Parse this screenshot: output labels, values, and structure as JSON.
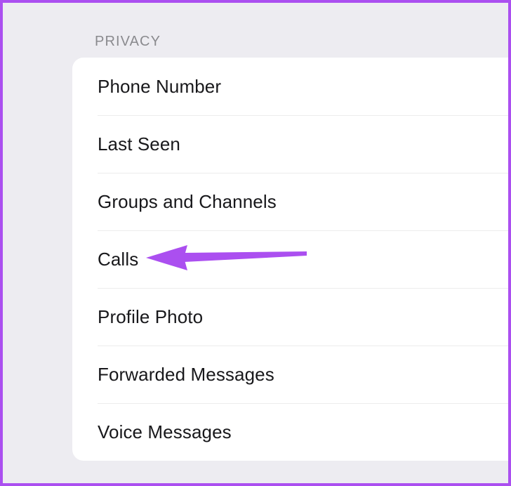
{
  "window": {
    "background_color": "#edecf1",
    "border_color": "#ab4ff0",
    "card_color": "#ffffff"
  },
  "section": {
    "header": "PRIVACY",
    "header_color": "#8a8a8e"
  },
  "settings_list": {
    "divider_color": "#ececec",
    "items": [
      {
        "label": "Phone Number"
      },
      {
        "label": "Last Seen"
      },
      {
        "label": "Groups and Channels"
      },
      {
        "label": "Calls"
      },
      {
        "label": "Profile Photo"
      },
      {
        "label": "Forwarded Messages"
      },
      {
        "label": "Voice Messages"
      }
    ]
  },
  "annotation": {
    "type": "arrow",
    "points_to": "Calls",
    "direction": "left",
    "color": "#ab4ff0"
  }
}
